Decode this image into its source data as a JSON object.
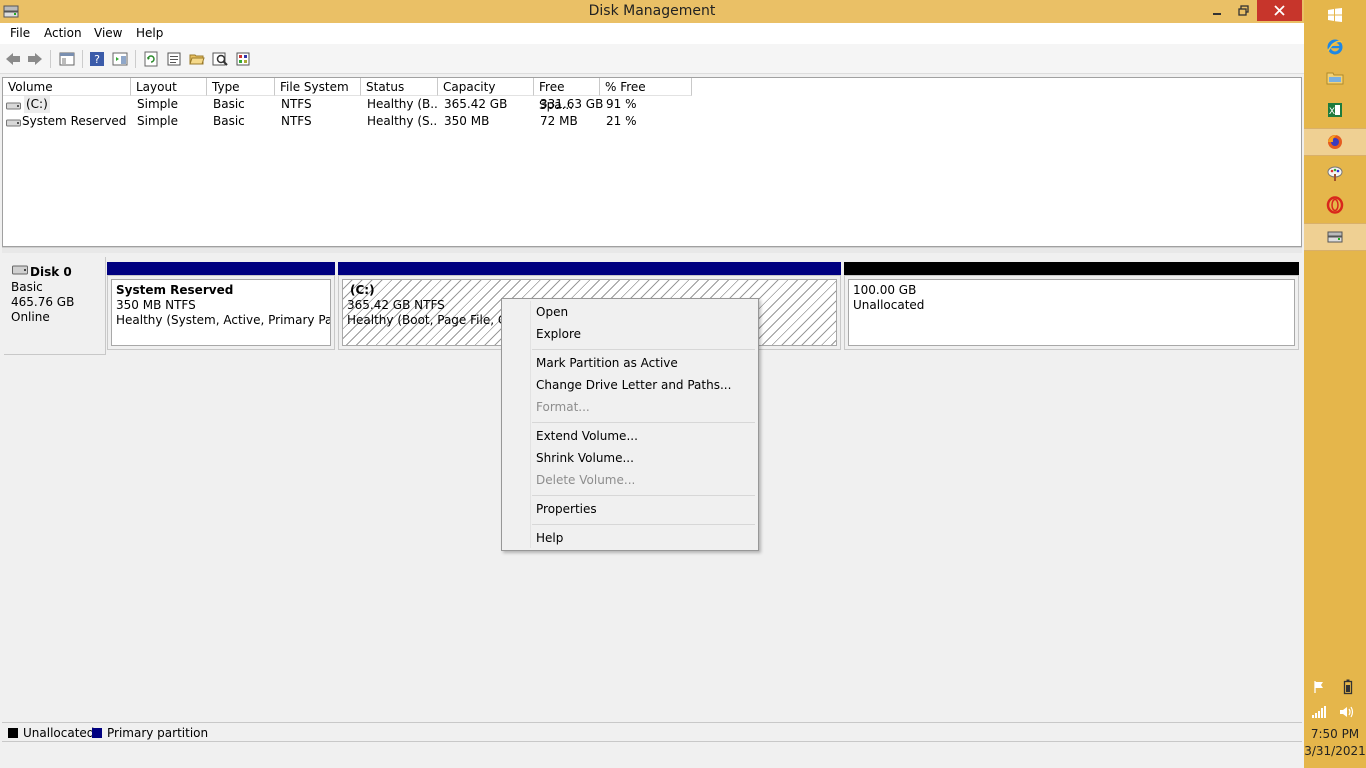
{
  "window": {
    "title": "Disk Management",
    "controls": {
      "minimize_icon": "minimize-icon",
      "maximize_icon": "restore-icon",
      "close_icon": "close-icon"
    }
  },
  "menu": [
    "File",
    "Action",
    "View",
    "Help"
  ],
  "toolbar": {
    "icons": [
      "back-icon",
      "forward-icon",
      "show-hide-console-tree-icon",
      "help-icon",
      "show-hide-action-pane-icon",
      "refresh-icon",
      "properties-icon",
      "open-icon",
      "explore-icon",
      "settings-icon"
    ]
  },
  "volume_list": {
    "columns": [
      "Volume",
      "Layout",
      "Type",
      "File System",
      "Status",
      "Capacity",
      "Free Spa...",
      "% Free"
    ],
    "rows": [
      {
        "volume": "(C:)",
        "layout": "Simple",
        "type": "Basic",
        "fs": "NTFS",
        "status": "Healthy (B...",
        "capacity": "365.42 GB",
        "free": "331.63 GB",
        "pct": "91 %"
      },
      {
        "volume": "System Reserved",
        "layout": "Simple",
        "type": "Basic",
        "fs": "NTFS",
        "status": "Healthy (S...",
        "capacity": "350 MB",
        "free": "72 MB",
        "pct": "21 %"
      }
    ]
  },
  "disk": {
    "name": "Disk 0",
    "type": "Basic",
    "size": "465.76 GB",
    "state": "Online",
    "partitions": [
      {
        "title": "System Reserved",
        "size": "350 MB NTFS",
        "status": "Healthy (System, Active, Primary Partition)"
      },
      {
        "title": "(C:)",
        "size": "365.42 GB NTFS",
        "status": "Healthy (Boot, Page File, Crash Dump, Primary Partition)"
      },
      {
        "title": "",
        "size": "100.00 GB",
        "status": "Unallocated"
      }
    ]
  },
  "legend": [
    {
      "label": "Unallocated",
      "color": "#000000"
    },
    {
      "label": "Primary partition",
      "color": "#000080"
    }
  ],
  "context_menu": {
    "items": [
      {
        "label": "Open",
        "enabled": true
      },
      {
        "label": "Explore",
        "enabled": true
      },
      {
        "label": "Mark Partition as Active",
        "enabled": true
      },
      {
        "label": "Change Drive Letter and Paths...",
        "enabled": true
      },
      {
        "label": "Format...",
        "enabled": false
      },
      {
        "label": "Extend Volume...",
        "enabled": true
      },
      {
        "label": "Shrink Volume...",
        "enabled": true
      },
      {
        "label": "Delete Volume...",
        "enabled": false
      },
      {
        "label": "Properties",
        "enabled": true
      },
      {
        "label": "Help",
        "enabled": true
      }
    ]
  },
  "taskbar": {
    "apps": [
      "start-icon",
      "internet-explorer-icon",
      "file-explorer-icon",
      "excel-icon",
      "firefox-icon",
      "paint-icon",
      "opera-icon",
      "disk-management-icon"
    ],
    "tray": [
      "flag-icon",
      "battery-icon",
      "network-icon",
      "volume-icon"
    ],
    "time": "7:50 PM",
    "date": "3/31/2021"
  },
  "colors": {
    "titlebar": "#eac066",
    "taskbar": "#e5b64b",
    "primary_partition": "#000080",
    "unallocated": "#000000",
    "close": "#c7352b"
  }
}
